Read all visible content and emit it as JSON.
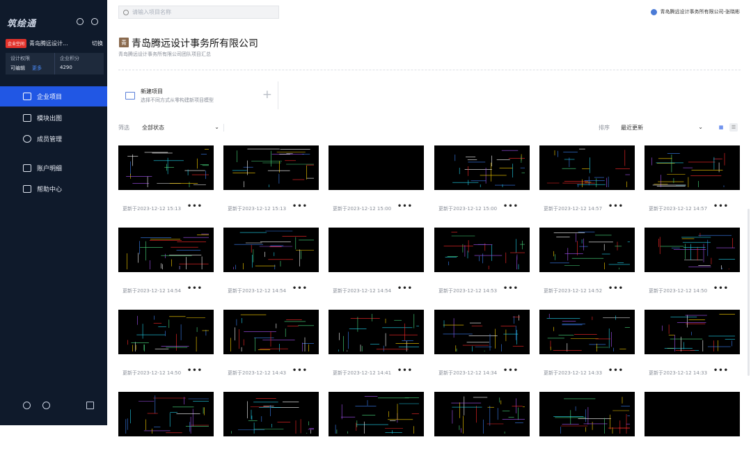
{
  "sidebar": {
    "logo": "筑绘通",
    "enterprise_tag": "企业空间",
    "enterprise_name": "青岛腾远设计...",
    "switch_label": "切换",
    "stat1_label": "设计权限",
    "stat1_value": "可编辑",
    "stat1_link": "更多",
    "stat2_label": "企业积分",
    "stat2_value": "4290",
    "items": [
      {
        "label": "企业项目",
        "active": true
      },
      {
        "label": "模块出图",
        "active": false
      },
      {
        "label": "成员管理",
        "active": false
      },
      {
        "label": "账户明细",
        "active": false
      },
      {
        "label": "帮助中心",
        "active": false
      }
    ]
  },
  "search": {
    "placeholder": "请输入项目名称"
  },
  "user_label": "青岛腾远设计事务所有限公司-张晓彬",
  "page": {
    "icon_char": "青",
    "title": "青岛腾远设计事务所有限公司",
    "subtitle": "青岛腾远设计事务所有限公司团队项目汇总"
  },
  "new_project": {
    "title": "新建项目",
    "desc": "选择不同方式从零构建新项目模型",
    "plus": "+"
  },
  "filter": {
    "label": "筛选",
    "value": "全部状态"
  },
  "sort": {
    "label": "排序",
    "value": "最近更新"
  },
  "cards": [
    {
      "updated": "更新于2023-12-12 15:13"
    },
    {
      "updated": "更新于2023-12-12 15:13"
    },
    {
      "updated": "更新于2023-12-12 15:00"
    },
    {
      "updated": "更新于2023-12-12 15:00"
    },
    {
      "updated": "更新于2023-12-12 14:57"
    },
    {
      "updated": "更新于2023-12-12 14:57"
    },
    {
      "updated": "更新于2023-12-12 14:54"
    },
    {
      "updated": "更新于2023-12-12 14:54"
    },
    {
      "updated": "更新于2023-12-12 14:54"
    },
    {
      "updated": "更新于2023-12-12 14:53"
    },
    {
      "updated": "更新于2023-12-12 14:52"
    },
    {
      "updated": "更新于2023-12-12 14:50"
    },
    {
      "updated": "更新于2023-12-12 14:50"
    },
    {
      "updated": "更新于2023-12-12 14:43"
    },
    {
      "updated": "更新于2023-12-12 14:41"
    },
    {
      "updated": "更新于2023-12-12 14:34"
    },
    {
      "updated": "更新于2023-12-12 14:33"
    },
    {
      "updated": "更新于2023-12-12 14:33"
    },
    {
      "updated": ""
    },
    {
      "updated": ""
    },
    {
      "updated": ""
    },
    {
      "updated": ""
    },
    {
      "updated": ""
    },
    {
      "updated": ""
    }
  ],
  "more_label": "•••"
}
